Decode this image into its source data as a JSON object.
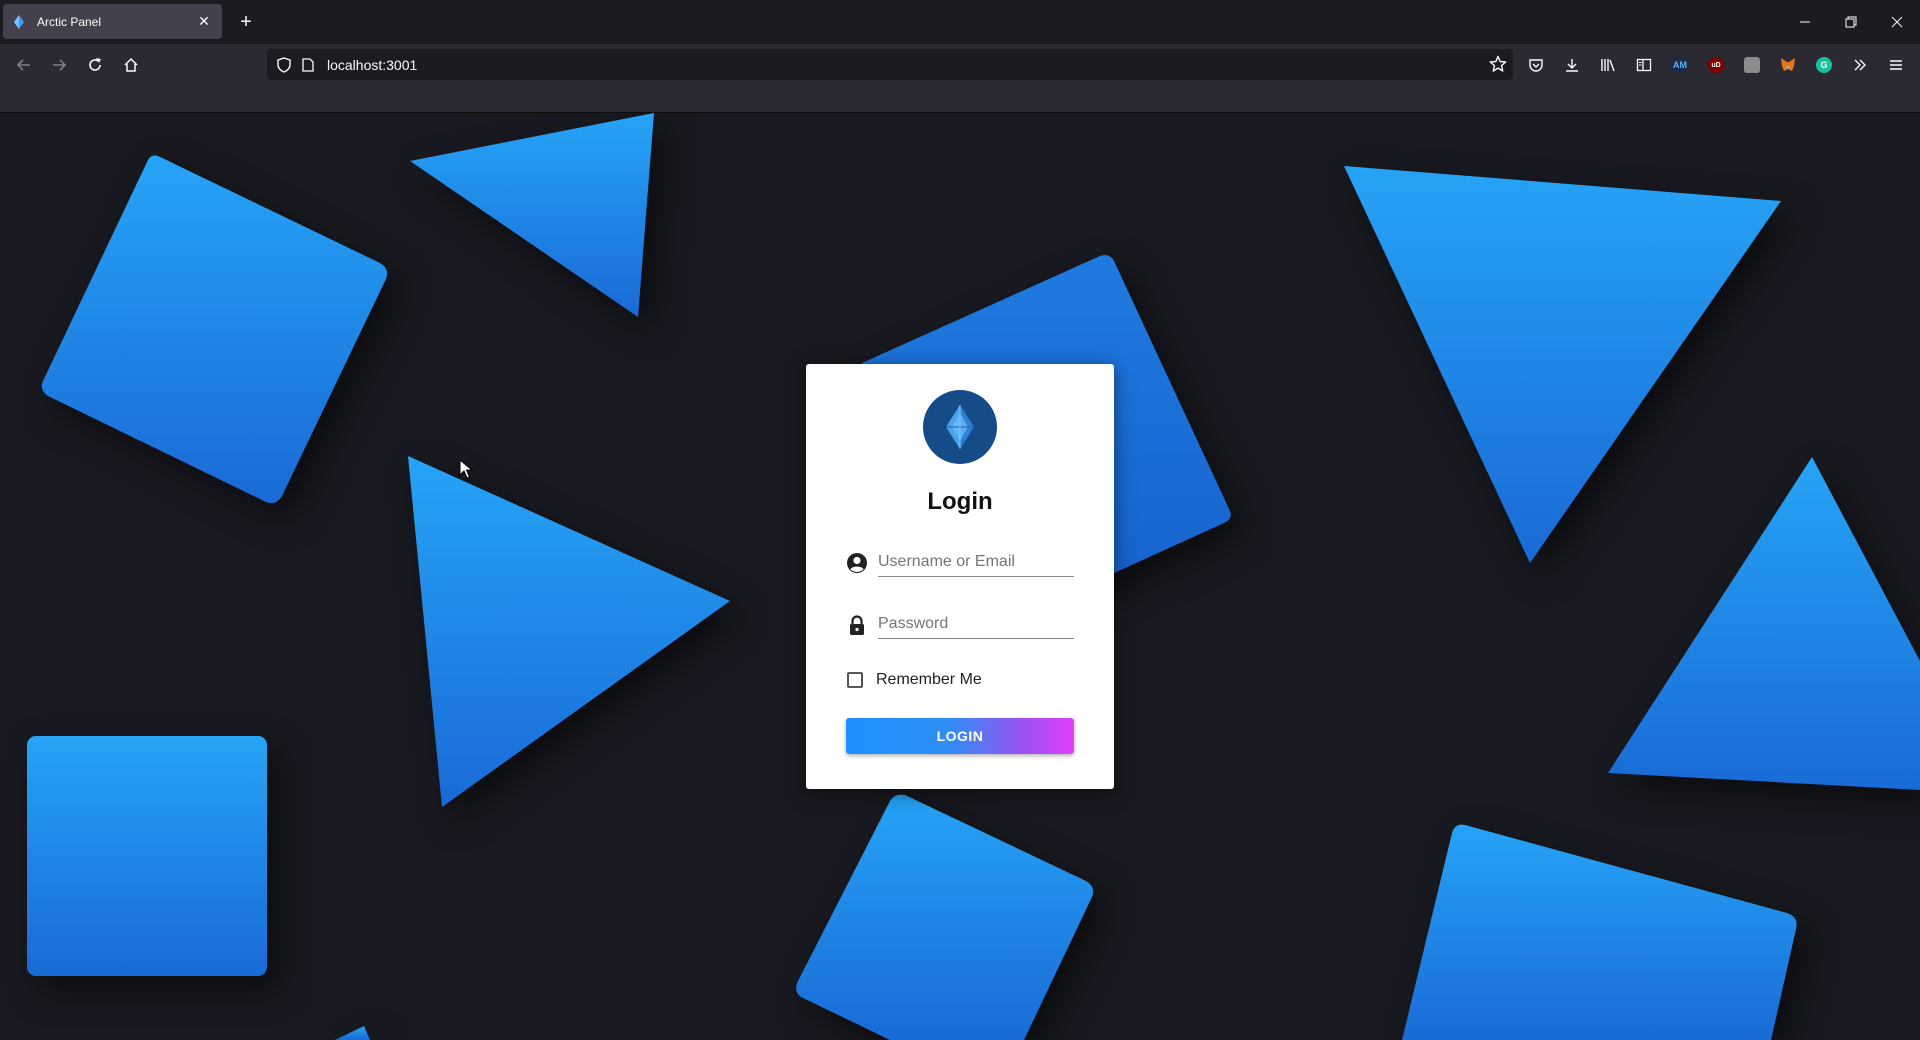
{
  "browser": {
    "tab": {
      "title": "Arctic Panel"
    },
    "url": "localhost:3001",
    "extensions": {
      "accent_ext": "AM",
      "ublock": "uD"
    }
  },
  "login": {
    "title": "Login",
    "username": {
      "placeholder": "Username or Email",
      "value": ""
    },
    "password": {
      "placeholder": "Password",
      "value": ""
    },
    "remember_label": "Remember Me",
    "remember_checked": false,
    "submit_label": "LOGIN"
  },
  "colors": {
    "background": "#191a21",
    "shape_light": "#26a4f6",
    "shape_dark": "#1a6ad6",
    "logo_bg": "#154b86",
    "button_start": "#1e90ff",
    "button_end": "#e040fb"
  }
}
